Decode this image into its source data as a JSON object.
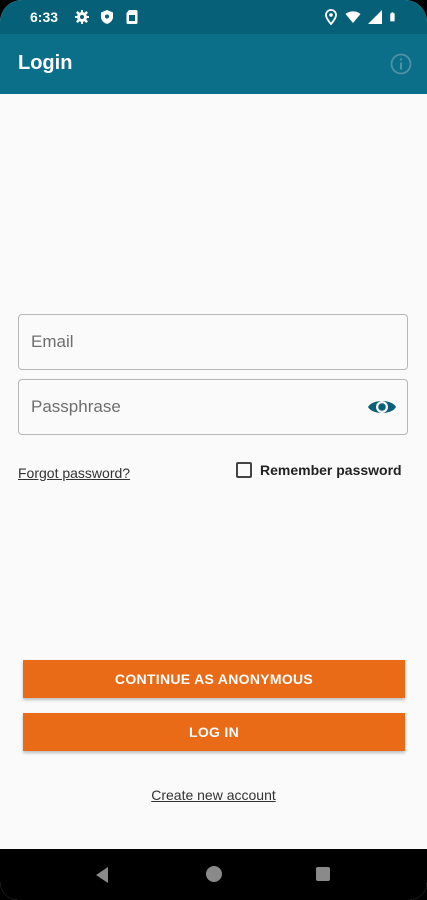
{
  "status_bar": {
    "time": "6:33",
    "left_icons": [
      "gear-icon",
      "shield-icon",
      "sim-card-icon"
    ],
    "right_icons": [
      "location-icon",
      "wifi-icon",
      "signal-icon",
      "battery-icon"
    ]
  },
  "app_bar": {
    "title": "Login",
    "info_icon": "info-icon"
  },
  "form": {
    "email_placeholder": "Email",
    "email_value": "",
    "passphrase_placeholder": "Passphrase",
    "passphrase_value": "",
    "visibility_icon": "eye-icon",
    "forgot_password": "Forgot password?",
    "remember_password": "Remember password",
    "remember_checked": false
  },
  "actions": {
    "continue_anonymous": "CONTINUE AS ANONYMOUS",
    "log_in": "LOG IN",
    "create_account": "Create new account"
  },
  "nav_bar": {
    "buttons": [
      "back-icon",
      "home-icon",
      "recents-icon"
    ]
  },
  "colors": {
    "status_bar": "#066178",
    "app_bar": "#0b6f8a",
    "accent_button": "#e96b17",
    "background": "#fafafa"
  }
}
